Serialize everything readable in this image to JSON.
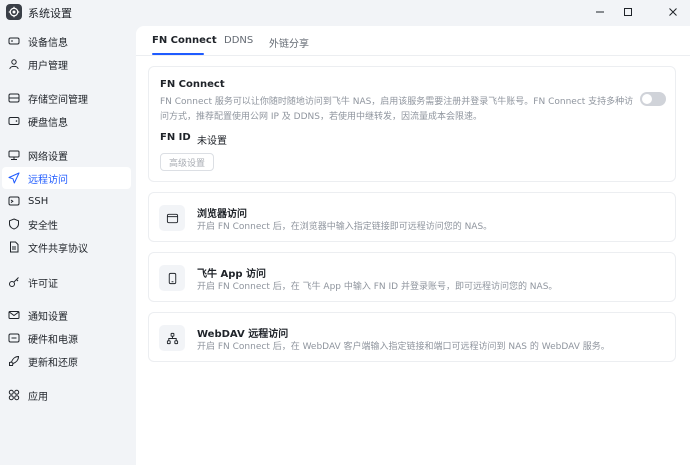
{
  "window": {
    "title": "系统设置"
  },
  "sidebar": {
    "items": [
      {
        "label": "设备信息",
        "icon": "device-icon",
        "active": false
      },
      {
        "label": "用户管理",
        "icon": "user-icon",
        "active": false
      },
      {
        "label": "存储空间管理",
        "icon": "storage-icon",
        "active": false
      },
      {
        "label": "硬盘信息",
        "icon": "disk-icon",
        "active": false
      },
      {
        "label": "网络设置",
        "icon": "network-icon",
        "active": false
      },
      {
        "label": "远程访问",
        "icon": "send-icon",
        "active": true
      },
      {
        "label": "SSH",
        "icon": "terminal-icon",
        "active": false
      },
      {
        "label": "安全性",
        "icon": "shield-icon",
        "active": false
      },
      {
        "label": "文件共享协议",
        "icon": "file-icon",
        "active": false
      },
      {
        "label": "许可证",
        "icon": "key-icon",
        "active": false
      },
      {
        "label": "通知设置",
        "icon": "mail-icon",
        "active": false
      },
      {
        "label": "硬件和电源",
        "icon": "chip-icon",
        "active": false
      },
      {
        "label": "更新和还原",
        "icon": "rocket-icon",
        "active": false
      },
      {
        "label": "应用",
        "icon": "apps-icon",
        "active": false
      }
    ]
  },
  "tabs": [
    {
      "label": "FN Connect",
      "active": true
    },
    {
      "label": "DDNS",
      "active": false
    },
    {
      "label": "外链分享",
      "active": false
    }
  ],
  "fn_connect": {
    "title": "FN Connect",
    "desc_line1": "FN Connect 服务可以让你随时随地访问到飞牛 NAS，启用该服务需要注册并登录飞牛账号。FN Connect 支持多种访",
    "desc_line2": "问方式，推荐配置使用公网 IP 及 DDNS，若使用中继转发，因流量成本会限速。",
    "id_label": "FN ID",
    "id_value": "未设置",
    "advanced_label": "高级设置",
    "enabled": false
  },
  "features": [
    {
      "title": "浏览器访问",
      "desc": "开启 FN Connect 后，在浏览器中输入指定链接即可远程访问您的 NAS。",
      "icon": "browser-icon"
    },
    {
      "title": "飞牛 App 访问",
      "desc": "开启 FN Connect 后，在 飞牛 App 中输入 FN ID 并登录账号，即可远程访问您的 NAS。",
      "icon": "phone-icon"
    },
    {
      "title": "WebDAV 远程访问",
      "desc": "开启 FN Connect 后，在 WebDAV 客户端输入指定链接和端口可远程访问到 NAS 的 WebDAV 服务。",
      "icon": "network-tree-icon"
    }
  ],
  "colors": {
    "accent": "#1f5bff",
    "background": "#f2f4f7",
    "panel": "#ffffff"
  }
}
